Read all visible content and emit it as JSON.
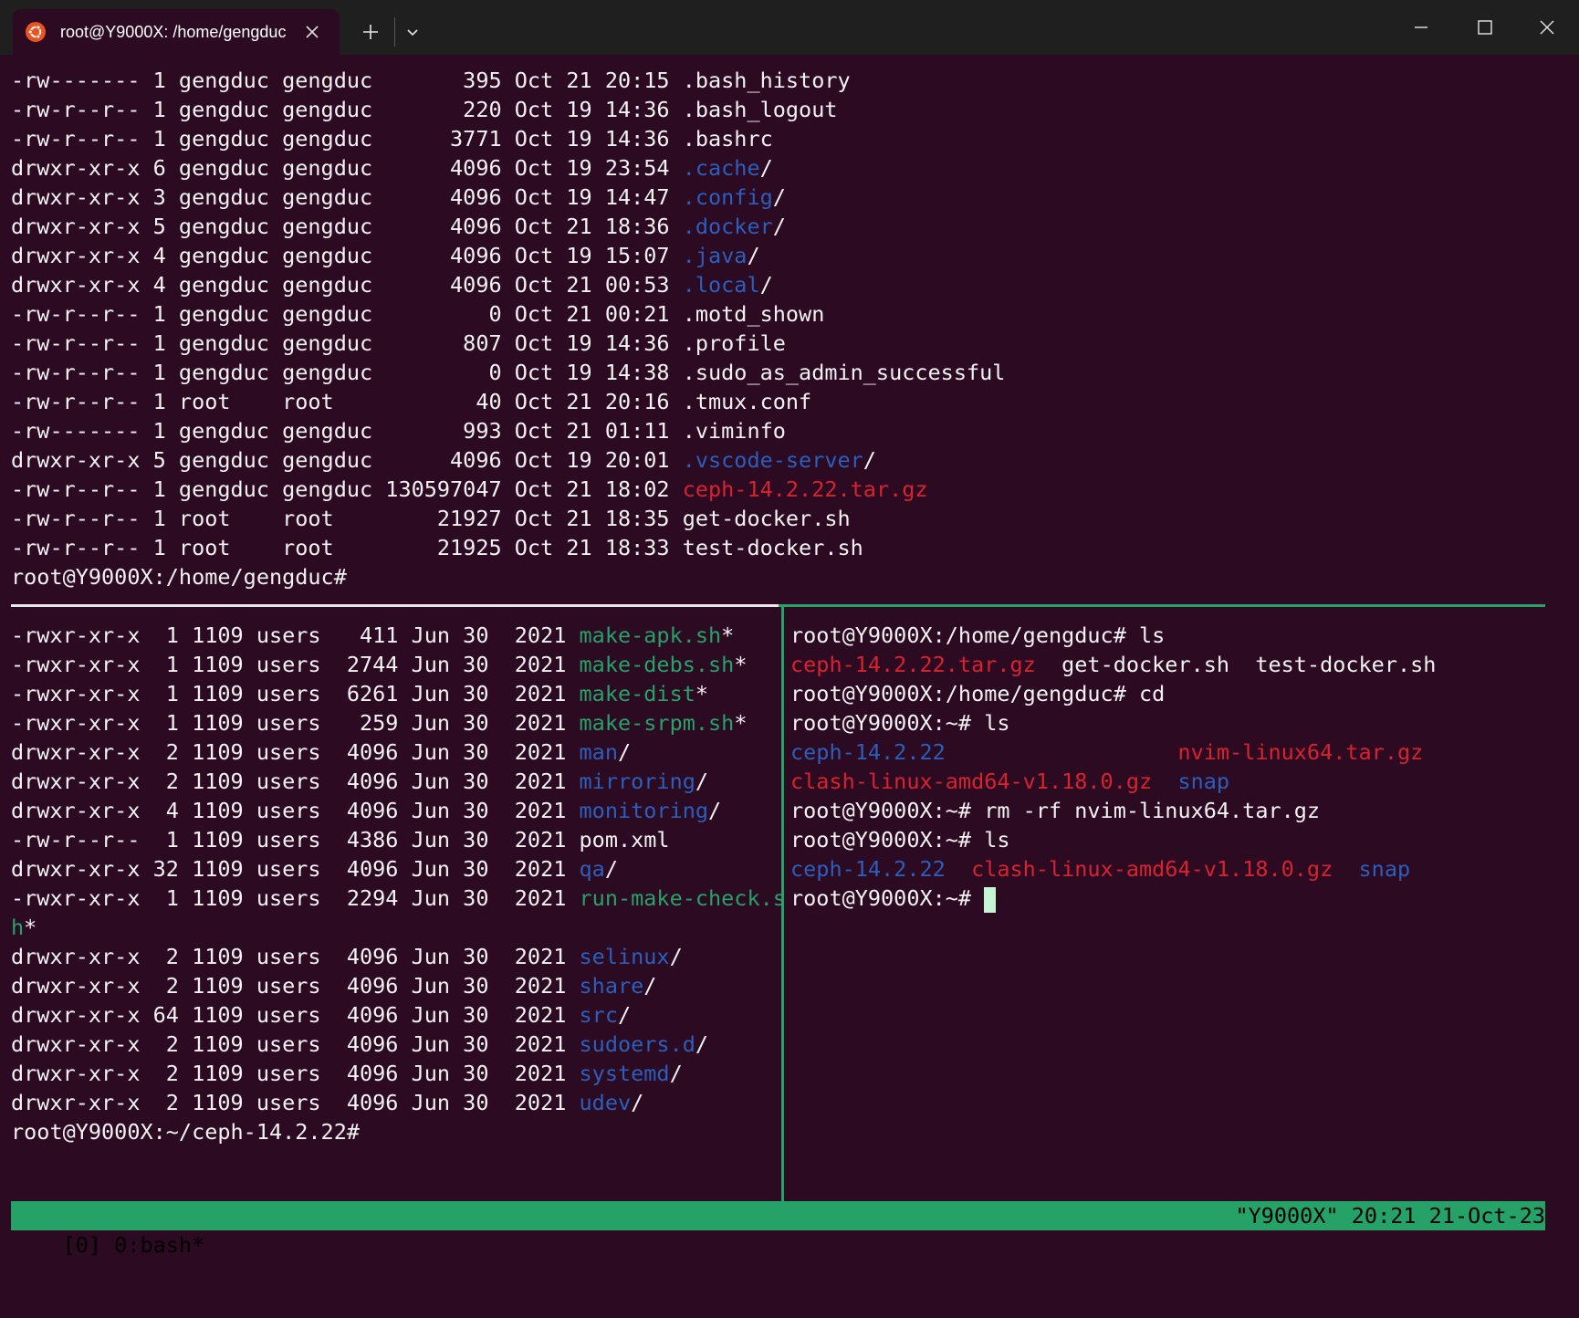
{
  "window": {
    "tab_title": "root@Y9000X: /home/gengduc",
    "tab_icon": "ubuntu-logo-icon",
    "new_tab": "plus-icon",
    "dropdown": "chevron-down-icon",
    "controls": [
      "minimize-icon",
      "maximize-icon",
      "close-icon"
    ]
  },
  "colors": {
    "background": "#2c0a22",
    "directory": "#2b5fbd",
    "archive": "#d8232f",
    "executable": "#26a269",
    "status_bar": "#26a269"
  },
  "top_pane": {
    "lines": [
      [
        {
          "t": "-rw------- 1 gengduc gengduc       395 Oct 21 20:15 .bash_history"
        }
      ],
      [
        {
          "t": "-rw-r--r-- 1 gengduc gengduc       220 Oct 19 14:36 .bash_logout"
        }
      ],
      [
        {
          "t": "-rw-r--r-- 1 gengduc gengduc      3771 Oct 19 14:36 .bashrc"
        }
      ],
      [
        {
          "t": "drwxr-xr-x 6 gengduc gengduc      4096 Oct 19 23:54 "
        },
        {
          "t": ".cache",
          "c": "blue"
        },
        {
          "t": "/"
        }
      ],
      [
        {
          "t": "drwxr-xr-x 3 gengduc gengduc      4096 Oct 19 14:47 "
        },
        {
          "t": ".config",
          "c": "blue"
        },
        {
          "t": "/"
        }
      ],
      [
        {
          "t": "drwxr-xr-x 5 gengduc gengduc      4096 Oct 21 18:36 "
        },
        {
          "t": ".docker",
          "c": "blue"
        },
        {
          "t": "/"
        }
      ],
      [
        {
          "t": "drwxr-xr-x 4 gengduc gengduc      4096 Oct 19 15:07 "
        },
        {
          "t": ".java",
          "c": "blue"
        },
        {
          "t": "/"
        }
      ],
      [
        {
          "t": "drwxr-xr-x 4 gengduc gengduc      4096 Oct 21 00:53 "
        },
        {
          "t": ".local",
          "c": "blue"
        },
        {
          "t": "/"
        }
      ],
      [
        {
          "t": "-rw-r--r-- 1 gengduc gengduc         0 Oct 21 00:21 .motd_shown"
        }
      ],
      [
        {
          "t": "-rw-r--r-- 1 gengduc gengduc       807 Oct 19 14:36 .profile"
        }
      ],
      [
        {
          "t": "-rw-r--r-- 1 gengduc gengduc         0 Oct 19 14:38 .sudo_as_admin_successful"
        }
      ],
      [
        {
          "t": "-rw-r--r-- 1 root    root           40 Oct 21 20:16 .tmux.conf"
        }
      ],
      [
        {
          "t": "-rw------- 1 gengduc gengduc       993 Oct 21 01:11 .viminfo"
        }
      ],
      [
        {
          "t": "drwxr-xr-x 5 gengduc gengduc      4096 Oct 19 20:01 "
        },
        {
          "t": ".vscode-server",
          "c": "blue"
        },
        {
          "t": "/"
        }
      ],
      [
        {
          "t": "-rw-r--r-- 1 gengduc gengduc 130597047 Oct 21 18:02 "
        },
        {
          "t": "ceph-14.2.22.tar.gz",
          "c": "red"
        }
      ],
      [
        {
          "t": "-rw-r--r-- 1 root    root        21927 Oct 21 18:35 get-docker.sh"
        }
      ],
      [
        {
          "t": "-rw-r--r-- 1 root    root        21925 Oct 21 18:33 test-docker.sh"
        }
      ],
      [
        {
          "t": "root@Y9000X:/home/gengduc#"
        }
      ]
    ]
  },
  "bottom_left_pane": {
    "lines": [
      [
        {
          "t": "-rwxr-xr-x  1 1109 users   411 Jun 30  2021 "
        },
        {
          "t": "make-apk.sh",
          "c": "green"
        },
        {
          "t": "*"
        }
      ],
      [
        {
          "t": "-rwxr-xr-x  1 1109 users  2744 Jun 30  2021 "
        },
        {
          "t": "make-debs.sh",
          "c": "green"
        },
        {
          "t": "*"
        }
      ],
      [
        {
          "t": "-rwxr-xr-x  1 1109 users  6261 Jun 30  2021 "
        },
        {
          "t": "make-dist",
          "c": "green"
        },
        {
          "t": "*"
        }
      ],
      [
        {
          "t": "-rwxr-xr-x  1 1109 users   259 Jun 30  2021 "
        },
        {
          "t": "make-srpm.sh",
          "c": "green"
        },
        {
          "t": "*"
        }
      ],
      [
        {
          "t": "drwxr-xr-x  2 1109 users  4096 Jun 30  2021 "
        },
        {
          "t": "man",
          "c": "blue"
        },
        {
          "t": "/"
        }
      ],
      [
        {
          "t": "drwxr-xr-x  2 1109 users  4096 Jun 30  2021 "
        },
        {
          "t": "mirroring",
          "c": "blue"
        },
        {
          "t": "/"
        }
      ],
      [
        {
          "t": "drwxr-xr-x  4 1109 users  4096 Jun 30  2021 "
        },
        {
          "t": "monitoring",
          "c": "blue"
        },
        {
          "t": "/"
        }
      ],
      [
        {
          "t": "-rw-r--r--  1 1109 users  4386 Jun 30  2021 pom.xml"
        }
      ],
      [
        {
          "t": "drwxr-xr-x 32 1109 users  4096 Jun 30  2021 "
        },
        {
          "t": "qa",
          "c": "blue"
        },
        {
          "t": "/"
        }
      ],
      [
        {
          "t": "-rwxr-xr-x  1 1109 users  2294 Jun 30  2021 "
        },
        {
          "t": "run-make-check.s",
          "c": "green"
        }
      ],
      [
        {
          "t": "h",
          "c": "green"
        },
        {
          "t": "*"
        }
      ],
      [
        {
          "t": "drwxr-xr-x  2 1109 users  4096 Jun 30  2021 "
        },
        {
          "t": "selinux",
          "c": "blue"
        },
        {
          "t": "/"
        }
      ],
      [
        {
          "t": "drwxr-xr-x  2 1109 users  4096 Jun 30  2021 "
        },
        {
          "t": "share",
          "c": "blue"
        },
        {
          "t": "/"
        }
      ],
      [
        {
          "t": "drwxr-xr-x 64 1109 users  4096 Jun 30  2021 "
        },
        {
          "t": "src",
          "c": "blue"
        },
        {
          "t": "/"
        }
      ],
      [
        {
          "t": "drwxr-xr-x  2 1109 users  4096 Jun 30  2021 "
        },
        {
          "t": "sudoers.d",
          "c": "blue"
        },
        {
          "t": "/"
        }
      ],
      [
        {
          "t": "drwxr-xr-x  2 1109 users  4096 Jun 30  2021 "
        },
        {
          "t": "systemd",
          "c": "blue"
        },
        {
          "t": "/"
        }
      ],
      [
        {
          "t": "drwxr-xr-x  2 1109 users  4096 Jun 30  2021 "
        },
        {
          "t": "udev",
          "c": "blue"
        },
        {
          "t": "/"
        }
      ],
      [
        {
          "t": "root@Y9000X:~/ceph-14.2.22#"
        }
      ]
    ]
  },
  "bottom_right_pane": {
    "lines": [
      [
        {
          "t": "root@Y9000X:/home/gengduc# ls"
        }
      ],
      [
        {
          "t": "ceph-14.2.22.tar.gz",
          "c": "red"
        },
        {
          "t": "  get-docker.sh  test-docker.sh"
        }
      ],
      [
        {
          "t": "root@Y9000X:/home/gengduc# cd"
        }
      ],
      [
        {
          "t": "root@Y9000X:~# ls"
        }
      ],
      [
        {
          "t": "ceph-14.2.22",
          "c": "blue"
        },
        {
          "t": "                  "
        },
        {
          "t": "nvim-linux64.tar.gz",
          "c": "red"
        }
      ],
      [
        {
          "t": "clash-linux-amd64-v1.18.0.gz",
          "c": "red"
        },
        {
          "t": "  "
        },
        {
          "t": "snap",
          "c": "blue"
        }
      ],
      [
        {
          "t": "root@Y9000X:~# rm -rf nvim-linux64.tar.gz"
        }
      ],
      [
        {
          "t": "root@Y9000X:~# ls"
        }
      ],
      [
        {
          "t": "ceph-14.2.22",
          "c": "blue"
        },
        {
          "t": "  "
        },
        {
          "t": "clash-linux-amd64-v1.18.0.gz",
          "c": "red"
        },
        {
          "t": "  "
        },
        {
          "t": "snap",
          "c": "blue"
        }
      ],
      [
        {
          "t": "root@Y9000X:~# "
        },
        {
          "cursor": true
        }
      ]
    ]
  },
  "status_bar": {
    "left": "[0] 0:bash*",
    "right": "\"Y9000X\" 20:21 21-Oct-23"
  }
}
